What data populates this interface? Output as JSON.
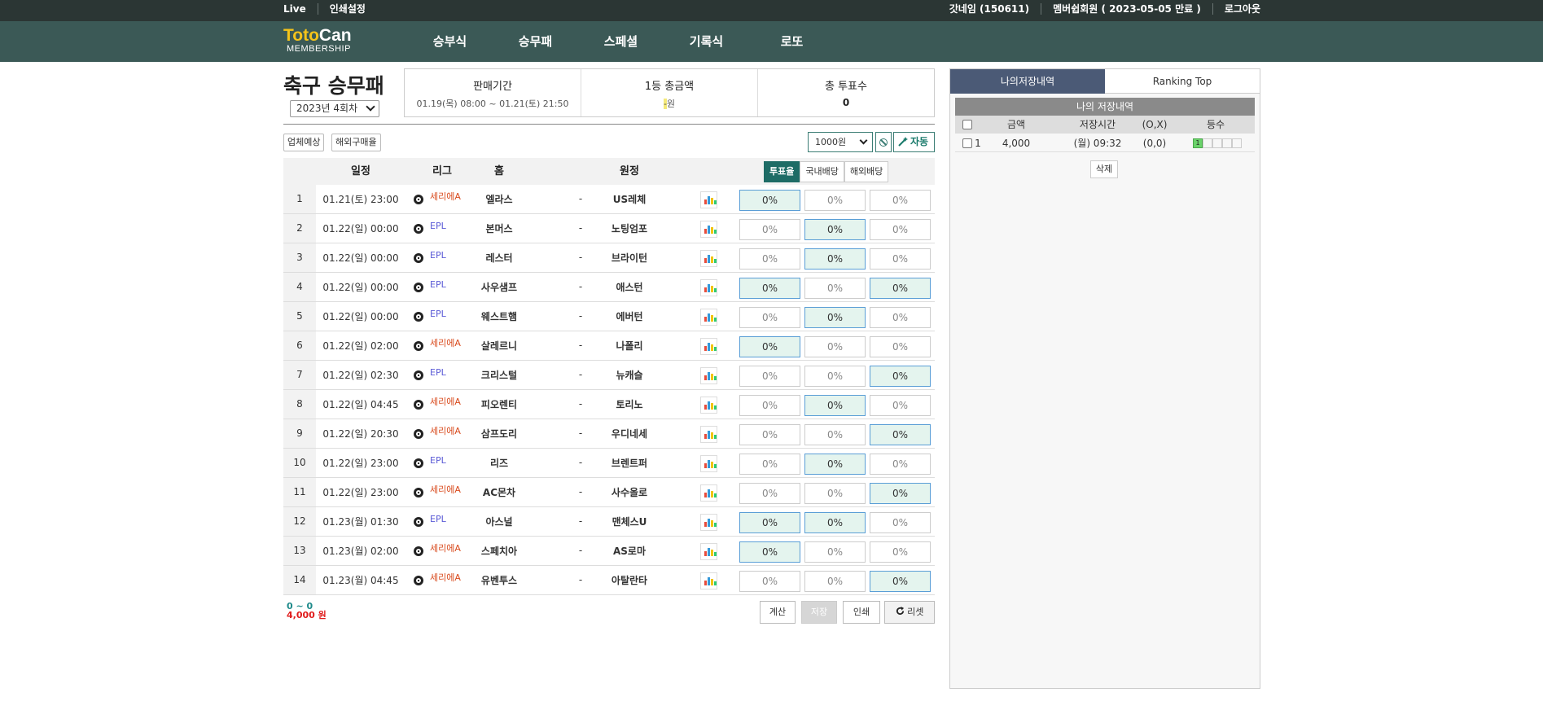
{
  "topbar": {
    "live": "Live",
    "print_settings": "인쇄설정",
    "user": "갓네임 (150611)",
    "membership": "멤버쉽회원 ( 2023-05-05 만료 )",
    "logout": "로그아웃"
  },
  "logo": {
    "part1": "Toto",
    "part2": "Can",
    "sub": "MEMBERSHIP"
  },
  "nav": [
    "승부식",
    "승무패",
    "스페셜",
    "기록식",
    "로또"
  ],
  "page": {
    "title": "축구 승무패",
    "round": "2023년 4회차"
  },
  "info": {
    "sale_label": "판매기간",
    "sale_value": "01.19(목) 08:00 ~ 01.21(토) 21:50",
    "first_prize_label": "1등 총금액",
    "first_prize_value": "-",
    "first_prize_unit": "원",
    "total_votes_label": "총 투표수",
    "total_votes_value": "0"
  },
  "toolbar": {
    "btn1": "업체예상",
    "btn2": "해외구매율",
    "amount": "1000원",
    "auto": "자동"
  },
  "table": {
    "headers": {
      "schedule": "일정",
      "league": "리그",
      "home": "홈",
      "away": "원정"
    },
    "tabs": [
      "투표율",
      "국내배당",
      "해외배당"
    ],
    "rows": [
      {
        "no": "1",
        "date": "01.21(토) 23:00",
        "league": "세리에A",
        "lg": "serie",
        "home": "엘라스",
        "away": "US레체",
        "sel": [
          true,
          false,
          false
        ]
      },
      {
        "no": "2",
        "date": "01.22(일) 00:00",
        "league": "EPL",
        "lg": "epl",
        "home": "본머스",
        "away": "노팅엄포",
        "sel": [
          false,
          true,
          false
        ]
      },
      {
        "no": "3",
        "date": "01.22(일) 00:00",
        "league": "EPL",
        "lg": "epl",
        "home": "레스터",
        "away": "브라이턴",
        "sel": [
          false,
          true,
          false
        ]
      },
      {
        "no": "4",
        "date": "01.22(일) 00:00",
        "league": "EPL",
        "lg": "epl",
        "home": "사우샘프",
        "away": "애스턴",
        "sel": [
          true,
          false,
          true
        ]
      },
      {
        "no": "5",
        "date": "01.22(일) 00:00",
        "league": "EPL",
        "lg": "epl",
        "home": "웨스트햄",
        "away": "에버턴",
        "sel": [
          false,
          true,
          false
        ]
      },
      {
        "no": "6",
        "date": "01.22(일) 02:00",
        "league": "세리에A",
        "lg": "serie",
        "home": "살레르니",
        "away": "나폴리",
        "sel": [
          true,
          false,
          false
        ]
      },
      {
        "no": "7",
        "date": "01.22(일) 02:30",
        "league": "EPL",
        "lg": "epl",
        "home": "크리스털",
        "away": "뉴캐슬",
        "sel": [
          false,
          false,
          true
        ]
      },
      {
        "no": "8",
        "date": "01.22(일) 04:45",
        "league": "세리에A",
        "lg": "serie",
        "home": "피오렌티",
        "away": "토리노",
        "sel": [
          false,
          true,
          false
        ]
      },
      {
        "no": "9",
        "date": "01.22(일) 20:30",
        "league": "세리에A",
        "lg": "serie",
        "home": "삼프도리",
        "away": "우디네세",
        "sel": [
          false,
          false,
          true
        ]
      },
      {
        "no": "10",
        "date": "01.22(일) 23:00",
        "league": "EPL",
        "lg": "epl",
        "home": "리즈",
        "away": "브렌트퍼",
        "sel": [
          false,
          true,
          false
        ]
      },
      {
        "no": "11",
        "date": "01.22(일) 23:00",
        "league": "세리에A",
        "lg": "serie",
        "home": "AC몬차",
        "away": "사수올로",
        "sel": [
          false,
          false,
          true
        ]
      },
      {
        "no": "12",
        "date": "01.23(월) 01:30",
        "league": "EPL",
        "lg": "epl",
        "home": "아스널",
        "away": "맨체스U",
        "sel": [
          true,
          true,
          false
        ]
      },
      {
        "no": "13",
        "date": "01.23(월) 02:00",
        "league": "세리에A",
        "lg": "serie",
        "home": "스페치아",
        "away": "AS로마",
        "sel": [
          true,
          false,
          false
        ]
      },
      {
        "no": "14",
        "date": "01.23(월) 04:45",
        "league": "세리에A",
        "lg": "serie",
        "home": "유벤투스",
        "away": "아탈란타",
        "sel": [
          false,
          false,
          true
        ]
      }
    ],
    "pct": "0%",
    "dash": "-"
  },
  "footer": {
    "range": "0 ~ 0",
    "total": "4,000 원",
    "calc": "계산",
    "save": "저장",
    "print": "인쇄",
    "reset": "리셋"
  },
  "right": {
    "tab1": "나의저장내역",
    "tab2": "Ranking Top",
    "header": "나의 저장내역",
    "cols": {
      "amount": "금액",
      "time": "저장시간",
      "ox": "(O,X)",
      "rank": "등수"
    },
    "row": {
      "no": "1",
      "amount": "4,000",
      "time": "(월) 09:32",
      "ox": "(0,0)",
      "rank": "1"
    },
    "delete": "삭제"
  },
  "colors": {
    "topbar": "#2b3634",
    "navbar": "#3b5956",
    "logo_accent": "#f4c31a",
    "active_tab": "#1e6c66",
    "selected_cell": "#e4f4ee",
    "serie": "#d94b1e",
    "epl": "#5a5ad6"
  }
}
